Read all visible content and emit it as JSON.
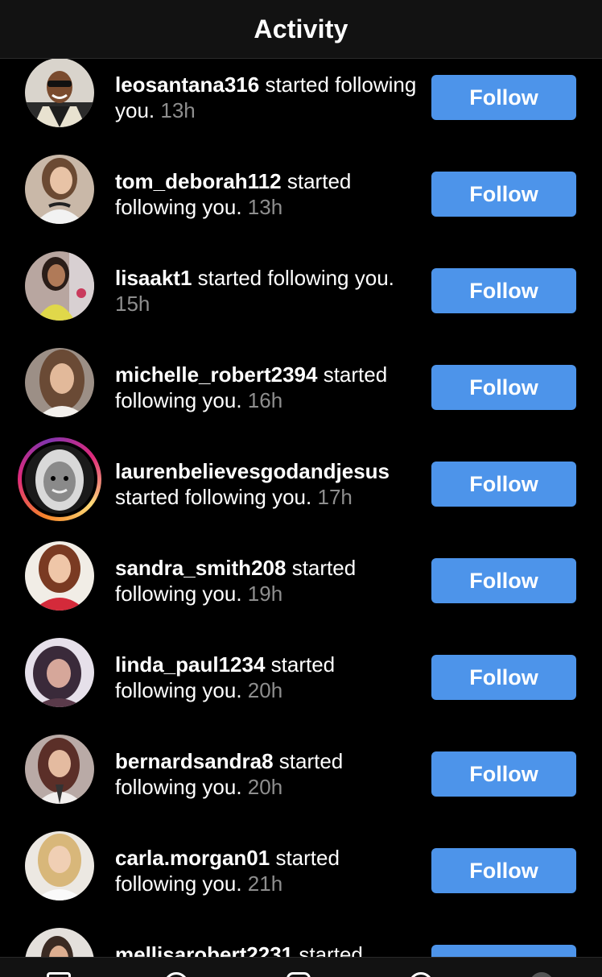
{
  "header": {
    "title": "Activity"
  },
  "follow_label": "Follow",
  "action_text": "started following you.",
  "items": [
    {
      "username": "leosantana316",
      "time": "13h"
    },
    {
      "username": "tom_deborah112",
      "time": "13h"
    },
    {
      "username": "lisaakt1",
      "time": "15h"
    },
    {
      "username": "michelle_robert2394",
      "time": "16h"
    },
    {
      "username": "laurenbelievesgodandjesus",
      "time": "17h"
    },
    {
      "username": "sandra_smith208",
      "time": "19h"
    },
    {
      "username": "linda_paul1234",
      "time": "20h"
    },
    {
      "username": "bernardsandra8",
      "time": "20h"
    },
    {
      "username": "carla.morgan01",
      "time": "21h"
    },
    {
      "username": "mellisarobert2231",
      "time": ""
    }
  ],
  "colors": {
    "background": "#000000",
    "follow_button": "#4d94ea",
    "muted_text": "#8e8e8e",
    "story_ring": "#dd2a7b"
  },
  "icons": {
    "tab_bar": [
      "home-icon",
      "search-icon",
      "add-post-icon",
      "activity-icon",
      "profile-icon"
    ]
  }
}
